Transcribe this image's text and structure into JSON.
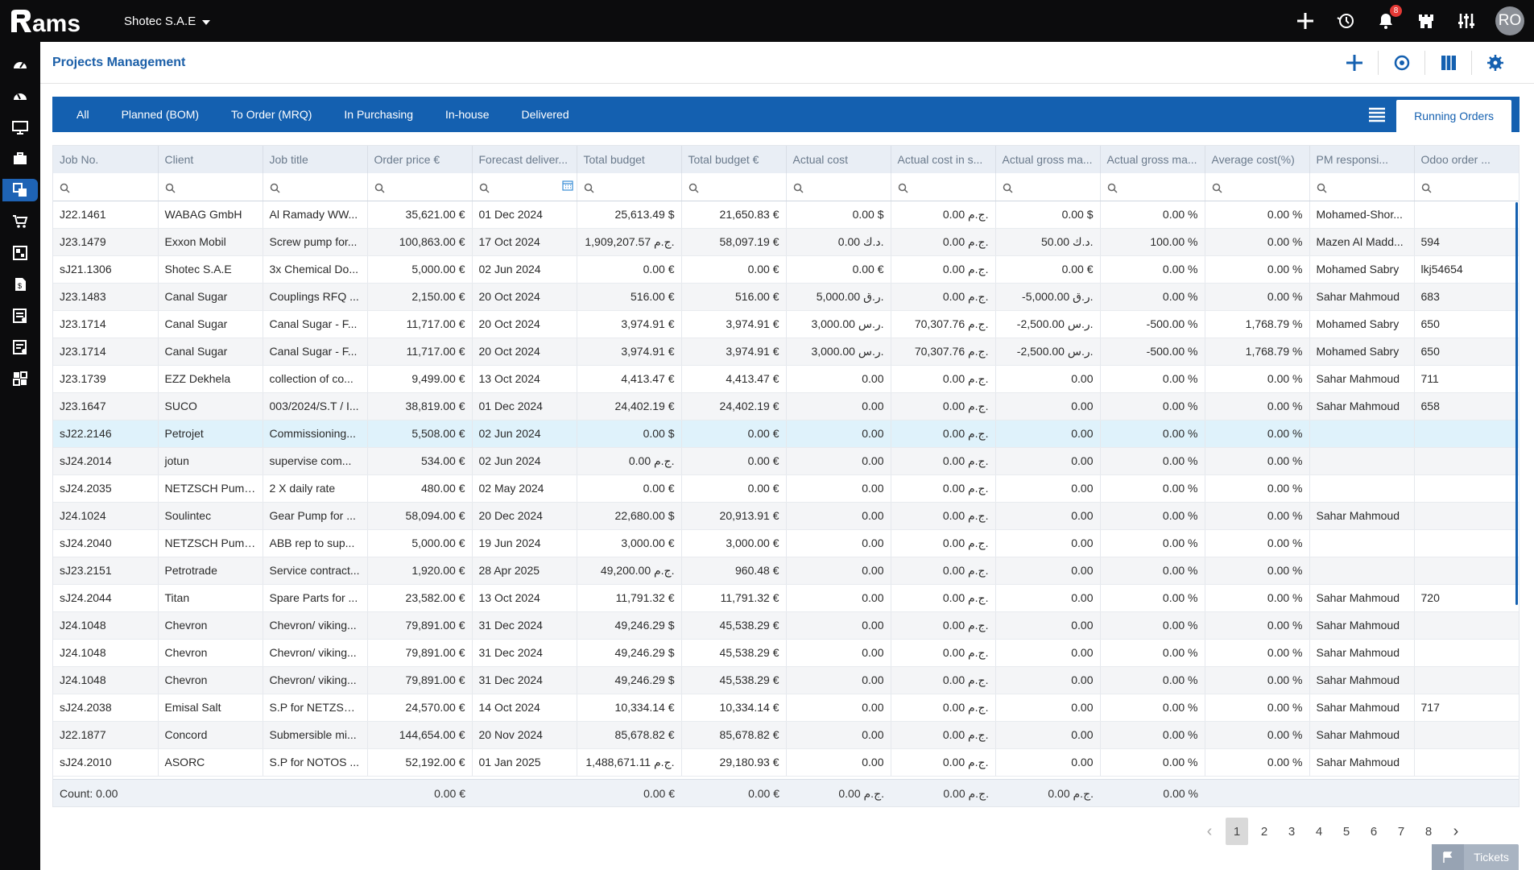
{
  "app": {
    "logo_text": "ams",
    "company": "Shotec S.A.E",
    "avatar_initials": "RO",
    "notification_count": "8"
  },
  "header": {
    "title": "Projects Management"
  },
  "tabs": [
    {
      "label": "All"
    },
    {
      "label": "Planned (BOM)"
    },
    {
      "label": "To Order (MRQ)"
    },
    {
      "label": "In Purchasing"
    },
    {
      "label": "In-house"
    },
    {
      "label": "Delivered"
    }
  ],
  "active_tab": "Running Orders",
  "columns": [
    "Job No.",
    "Client",
    "Job title",
    "Order price €",
    "Forecast deliver...",
    "Total budget",
    "Total budget €",
    "Actual cost",
    "Actual cost in s...",
    "Actual gross ma...",
    "Actual gross ma...",
    "Average cost(%)",
    "PM responsi...",
    "Odoo order ..."
  ],
  "rows": [
    [
      "J22.1461",
      "WABAG GmbH",
      "Al Ramady WW...",
      "35,621.00 €",
      "01 Dec 2024",
      "25,613.49 $",
      "21,650.83 €",
      "0.00 $",
      "0.00 ج.م.",
      "0.00 $",
      "0.00 %",
      "0.00 %",
      "Mohamed-Shor...",
      ""
    ],
    [
      "J23.1479",
      "Exxon Mobil",
      "Screw pump for...",
      "100,863.00 €",
      "17 Oct 2024",
      "1,909,207.57 ج.م.",
      "58,097.19 €",
      "0.00 د.ك.",
      "0.00 ج.م.",
      "50.00 د.ك.",
      "100.00 %",
      "0.00 %",
      "Mazen Al Madd...",
      "594"
    ],
    [
      "sJ21.1306",
      "Shotec S.A.E",
      "3x Chemical Do...",
      "5,000.00 €",
      "02 Jun 2024",
      "0.00 €",
      "0.00 €",
      "0.00 €",
      "0.00 ج.م.",
      "0.00 €",
      "0.00 %",
      "0.00 %",
      "Mohamed Sabry",
      "lkj54654"
    ],
    [
      "J23.1483",
      "Canal Sugar",
      "Couplings RFQ ...",
      "2,150.00 €",
      "20 Oct 2024",
      "516.00 €",
      "516.00 €",
      "5,000.00 ر.ق.",
      "0.00 ج.م.",
      "-5,000.00 ر.ق.",
      "0.00 %",
      "0.00 %",
      "Sahar Mahmoud",
      "683"
    ],
    [
      "J23.1714",
      "Canal Sugar",
      "Canal Sugar - F...",
      "11,717.00 €",
      "20 Oct 2024",
      "3,974.91 €",
      "3,974.91 €",
      "3,000.00 ر.س.",
      "70,307.76 ج.م.",
      "-2,500.00 ر.س.",
      "-500.00 %",
      "1,768.79 %",
      "Mohamed Sabry",
      "650"
    ],
    [
      "J23.1714",
      "Canal Sugar",
      "Canal Sugar - F...",
      "11,717.00 €",
      "20 Oct 2024",
      "3,974.91 €",
      "3,974.91 €",
      "3,000.00 ر.س.",
      "70,307.76 ج.م.",
      "-2,500.00 ر.س.",
      "-500.00 %",
      "1,768.79 %",
      "Mohamed Sabry",
      "650"
    ],
    [
      "J23.1739",
      "EZZ Dekhela",
      "collection of co...",
      "9,499.00 €",
      "13 Oct 2024",
      "4,413.47 €",
      "4,413.47 €",
      "0.00",
      "0.00 ج.م.",
      "0.00",
      "0.00 %",
      "0.00 %",
      "Sahar Mahmoud",
      "711"
    ],
    [
      "J23.1647",
      "SUCO",
      "003/2024/S.T / I...",
      "38,819.00 €",
      "01 Dec 2024",
      "24,402.19 €",
      "24,402.19 €",
      "0.00",
      "0.00 ج.م.",
      "0.00",
      "0.00 %",
      "0.00 %",
      "Sahar Mahmoud",
      "658"
    ],
    [
      "sJ22.2146",
      "Petrojet",
      "Commissioning...",
      "5,508.00 €",
      "02 Jun 2024",
      "0.00 $",
      "0.00 €",
      "0.00",
      "0.00 ج.م.",
      "0.00",
      "0.00 %",
      "0.00 %",
      "",
      ""
    ],
    [
      "sJ24.2014",
      "jotun",
      "supervise com...",
      "534.00 €",
      "02 Jun 2024",
      "0.00 ج.م.",
      "0.00 €",
      "0.00",
      "0.00 ج.م.",
      "0.00",
      "0.00 %",
      "0.00 %",
      "",
      ""
    ],
    [
      "sJ24.2035",
      "NETZSCH Pump...",
      "2 X daily rate",
      "480.00 €",
      "02 May 2024",
      "0.00 €",
      "0.00 €",
      "0.00",
      "0.00 ج.م.",
      "0.00",
      "0.00 %",
      "0.00 %",
      "",
      ""
    ],
    [
      "J24.1024",
      "Soulintec",
      "Gear Pump for ...",
      "58,094.00 €",
      "20 Dec 2024",
      "22,680.00 $",
      "20,913.91 €",
      "0.00",
      "0.00 ج.م.",
      "0.00",
      "0.00 %",
      "0.00 %",
      "Sahar Mahmoud",
      ""
    ],
    [
      "sJ24.2040",
      "NETZSCH Pump...",
      "ABB rep to sup...",
      "5,000.00 €",
      "19 Jun 2024",
      "3,000.00 €",
      "3,000.00 €",
      "0.00",
      "0.00 ج.م.",
      "0.00",
      "0.00 %",
      "0.00 %",
      "",
      ""
    ],
    [
      "sJ23.2151",
      "Petrotrade",
      "Service contract...",
      "1,920.00 €",
      "28 Apr 2025",
      "49,200.00 ج.م.",
      "960.48 €",
      "0.00",
      "0.00 ج.م.",
      "0.00",
      "0.00 %",
      "0.00 %",
      "",
      ""
    ],
    [
      "sJ24.2044",
      "Titan",
      "Spare Parts for ...",
      "23,582.00 €",
      "13 Oct 2024",
      "11,791.32 €",
      "11,791.32 €",
      "0.00",
      "0.00 ج.م.",
      "0.00",
      "0.00 %",
      "0.00 %",
      "Sahar Mahmoud",
      "720"
    ],
    [
      "J24.1048",
      "Chevron",
      "Chevron/ viking...",
      "79,891.00 €",
      "31 Dec 2024",
      "49,246.29 $",
      "45,538.29 €",
      "0.00",
      "0.00 ج.م.",
      "0.00",
      "0.00 %",
      "0.00 %",
      "Sahar Mahmoud",
      ""
    ],
    [
      "J24.1048",
      "Chevron",
      "Chevron/ viking...",
      "79,891.00 €",
      "31 Dec 2024",
      "49,246.29 $",
      "45,538.29 €",
      "0.00",
      "0.00 ج.م.",
      "0.00",
      "0.00 %",
      "0.00 %",
      "Sahar Mahmoud",
      ""
    ],
    [
      "J24.1048",
      "Chevron",
      "Chevron/ viking...",
      "79,891.00 €",
      "31 Dec 2024",
      "49,246.29 $",
      "45,538.29 €",
      "0.00",
      "0.00 ج.م.",
      "0.00",
      "0.00 %",
      "0.00 %",
      "Sahar Mahmoud",
      ""
    ],
    [
      "sJ24.2038",
      "Emisal Salt",
      "S.P for NETZSC...",
      "24,570.00 €",
      "14 Oct 2024",
      "10,334.14 €",
      "10,334.14 €",
      "0.00",
      "0.00 ج.م.",
      "0.00",
      "0.00 %",
      "0.00 %",
      "Sahar Mahmoud",
      "717"
    ],
    [
      "J22.1877",
      "Concord",
      "Submersible mi...",
      "144,654.00 €",
      "20 Nov 2024",
      "85,678.82 €",
      "85,678.82 €",
      "0.00",
      "0.00 ج.م.",
      "0.00",
      "0.00 %",
      "0.00 %",
      "Sahar Mahmoud",
      ""
    ],
    [
      "sJ24.2010",
      "ASORC",
      "S.P for NOTOS ...",
      "52,192.00 €",
      "01 Jan 2025",
      "1,488,671.11 ج.م.",
      "29,180.93 €",
      "0.00",
      "0.00 ج.م.",
      "0.00",
      "0.00 %",
      "0.00 %",
      "Sahar Mahmoud",
      ""
    ]
  ],
  "selected_row": 8,
  "footer": {
    "count": "Count: 0.00",
    "order_price": "0.00 €",
    "total_budget": "0.00 €",
    "total_budget_eur": "0.00 €",
    "actual_cost": "0.00 ج.م.",
    "actual_cost_s": "0.00 ج.م.",
    "gross_margin": "0.00 ج.م.",
    "gross_margin_pct": "0.00 %"
  },
  "pagination": {
    "pages": [
      "1",
      "2",
      "3",
      "4",
      "5",
      "6",
      "7",
      "8"
    ],
    "current": "1"
  },
  "tickets_label": "Tickets",
  "colors": {
    "topbar": "#0c0c0d",
    "accent": "#1460b0",
    "title": "#1b5fa8",
    "selected_row": "#dff2fb"
  }
}
